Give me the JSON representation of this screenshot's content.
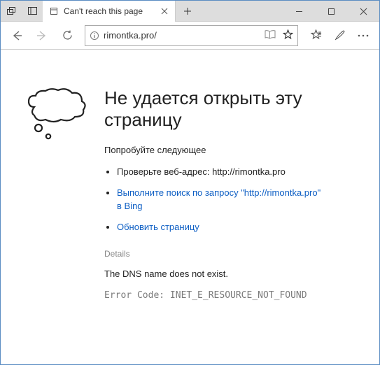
{
  "tab": {
    "title": "Can't reach this page"
  },
  "address": {
    "url": "rimontka.pro/"
  },
  "page": {
    "heading": "Не удается открыть эту страницу",
    "try_label": "Попробуйте следующее",
    "suggest1_prefix": "Проверьте веб-адрес: ",
    "suggest1_url": "http://rimontka.pro",
    "suggest2": "Выполните поиск по запросу \"http://rimontka.pro\" в Bing",
    "suggest3": "Обновить страницу",
    "details_label": "Details",
    "details_text": "The DNS name does not exist.",
    "error_code_label": "Error Code: ",
    "error_code": "INET_E_RESOURCE_NOT_FOUND"
  }
}
